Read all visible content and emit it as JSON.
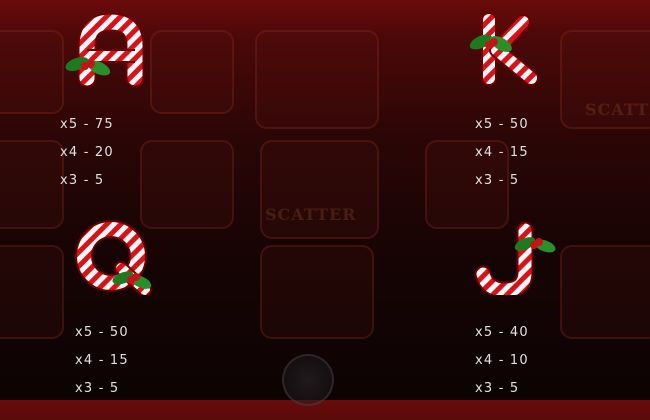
{
  "symbols": [
    {
      "name": "A",
      "payouts": [
        {
          "label": "x5  -  75"
        },
        {
          "label": "x4  -  20"
        },
        {
          "label": "x3  -  5"
        }
      ]
    },
    {
      "name": "K",
      "payouts": [
        {
          "label": "x5  -  50"
        },
        {
          "label": "x4  -  15"
        },
        {
          "label": "x3  -  5"
        }
      ]
    },
    {
      "name": "Q",
      "payouts": [
        {
          "label": "x5  -  50"
        },
        {
          "label": "x4  -  15"
        },
        {
          "label": "x3  -  5"
        }
      ]
    },
    {
      "name": "J",
      "payouts": [
        {
          "label": "x5  -  40"
        },
        {
          "label": "x4  -  10"
        },
        {
          "label": "x3  -  5"
        }
      ]
    }
  ],
  "background": {
    "scatter_label": "SCATTER"
  },
  "colors": {
    "candy_red": "#d8121b",
    "candy_white": "#ffffff",
    "holly_green": "#1f7a1f",
    "berry_red": "#c4141a",
    "text": "#e0e0e0"
  }
}
